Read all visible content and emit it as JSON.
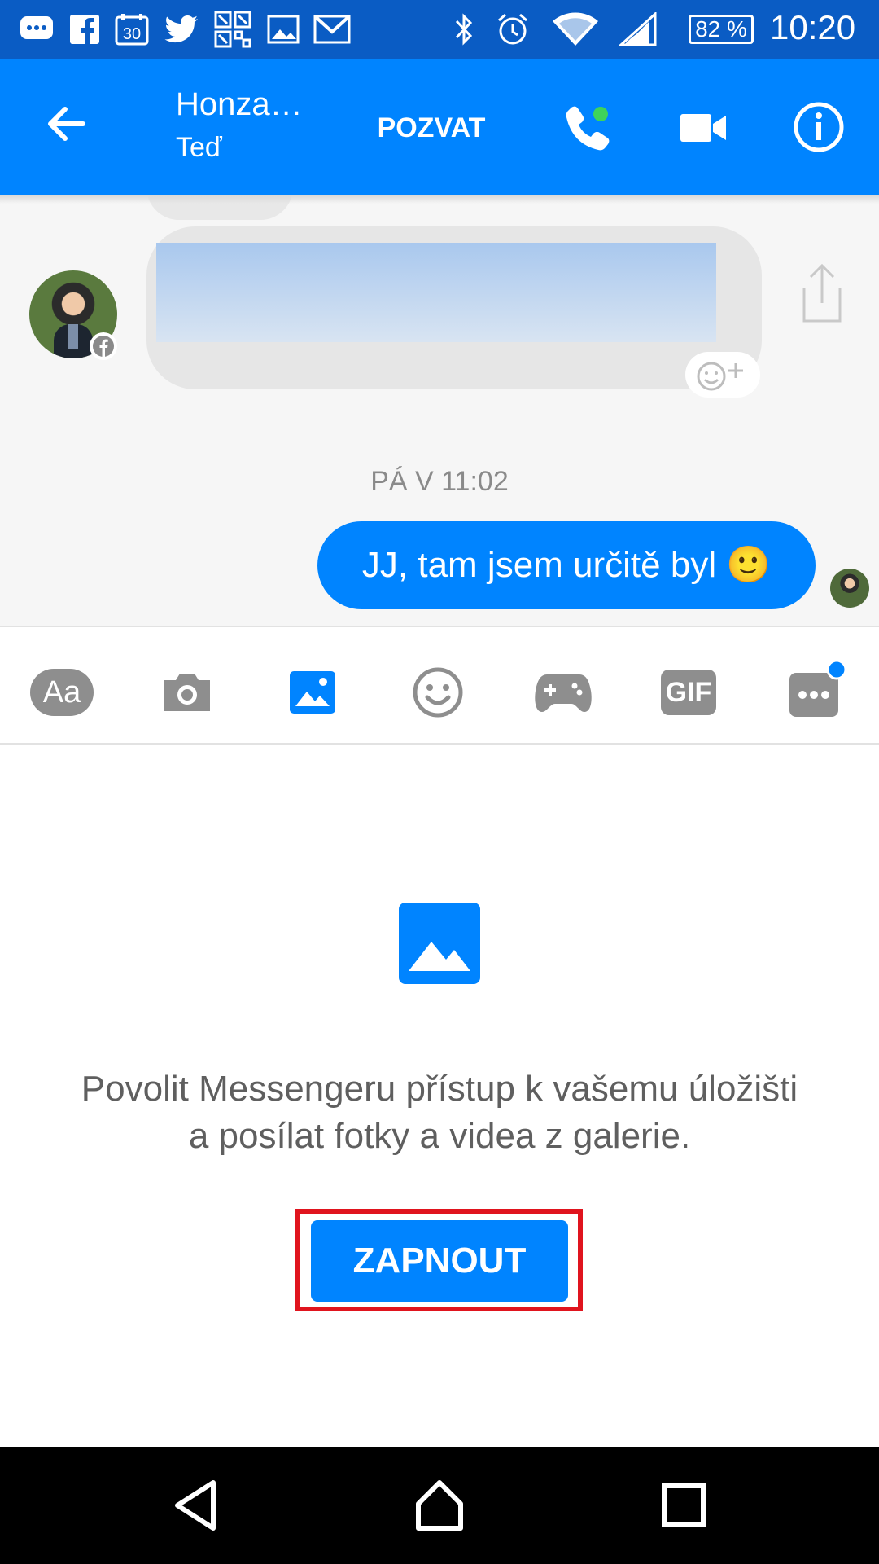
{
  "status_bar": {
    "battery": "82 %",
    "time": "10:20",
    "icons": [
      "messages-icon",
      "facebook-icon",
      "calendar-icon",
      "twitter-icon",
      "qr-icon",
      "gallery-icon",
      "gmail-icon",
      "bluetooth-icon",
      "alarm-icon",
      "wifi-icon",
      "signal-icon",
      "battery-icon"
    ],
    "calendar_day": "30"
  },
  "app_bar": {
    "contact_name": "Honza…",
    "contact_status": "Teď",
    "invite_label": "POZVAT"
  },
  "conversation": {
    "timestamp": "PÁ V 11:02",
    "my_message": "JJ, tam jsem určitě byl 🙂"
  },
  "composer": {
    "text_tool_label": "Aa",
    "gif_label": "GIF",
    "active_tool": "gallery"
  },
  "permission": {
    "message": "Povolit Messengeru přístup k vašemu úložišti a posílat fotky a videa z galerie.",
    "enable_label": "ZAPNOUT"
  },
  "colors": {
    "accent": "#0084ff",
    "status_bar": "#0a5cc4",
    "highlight_frame": "#e0141e"
  }
}
